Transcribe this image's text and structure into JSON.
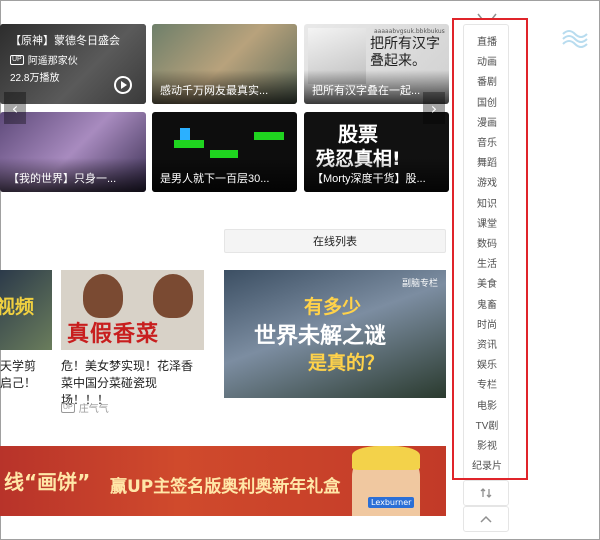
{
  "cards": [
    {
      "title": "【原神】蒙德冬日盛会",
      "up": "阿遥那家伙",
      "views": "22.8万播放",
      "up_badge": "UP"
    },
    {
      "caption": "感动千万网友最真实..."
    },
    {
      "caption": "把所有汉字叠在一起...",
      "overlay_title": "把所有汉字叠起来。",
      "overlay_small": "aaaaabvgsuk.bbkbukus"
    },
    {
      "caption": "【我的世界】只身一..."
    },
    {
      "caption": "是男人就下一百层30..."
    },
    {
      "caption": "【Morty深度干货】股...",
      "overlay_line1": "股票",
      "overlay_line2": "残忍真相!"
    }
  ],
  "online_list_label": "在线列表",
  "row2": [
    {
      "overlay": "视频",
      "caption_lines": [
        "天学剪",
        "启己！"
      ]
    },
    {
      "overlay": "真假香菜",
      "caption": "危！美女梦实现！花泽香菜中国分菜碰瓷现场！！！",
      "up": "庄气气",
      "up_badge": "UP"
    },
    {
      "overlay_line1": "有多少",
      "overlay_line2": "世界未解之谜",
      "overlay_line3": "是真的？",
      "tag": "副脑专栏"
    }
  ],
  "banner": {
    "left_text": "线“画饼”",
    "main_text": "赢UP主签名版奥利奥新年礼盒",
    "person_tag": "Lexburner"
  },
  "sidebar": {
    "items": [
      "直播",
      "动画",
      "番剧",
      "国创",
      "漫画",
      "音乐",
      "舞蹈",
      "游戏",
      "知识",
      "课堂",
      "数码",
      "生活",
      "美食",
      "鬼畜",
      "时尚",
      "资讯",
      "娱乐",
      "专栏",
      "电影",
      "TV剧",
      "影视",
      "纪录片"
    ],
    "sort_icon": "sort-icon",
    "top_icon": "back-to-top-icon"
  },
  "colors": {
    "highlight": "#e0242a",
    "accent_blue": "#00a1d6"
  }
}
